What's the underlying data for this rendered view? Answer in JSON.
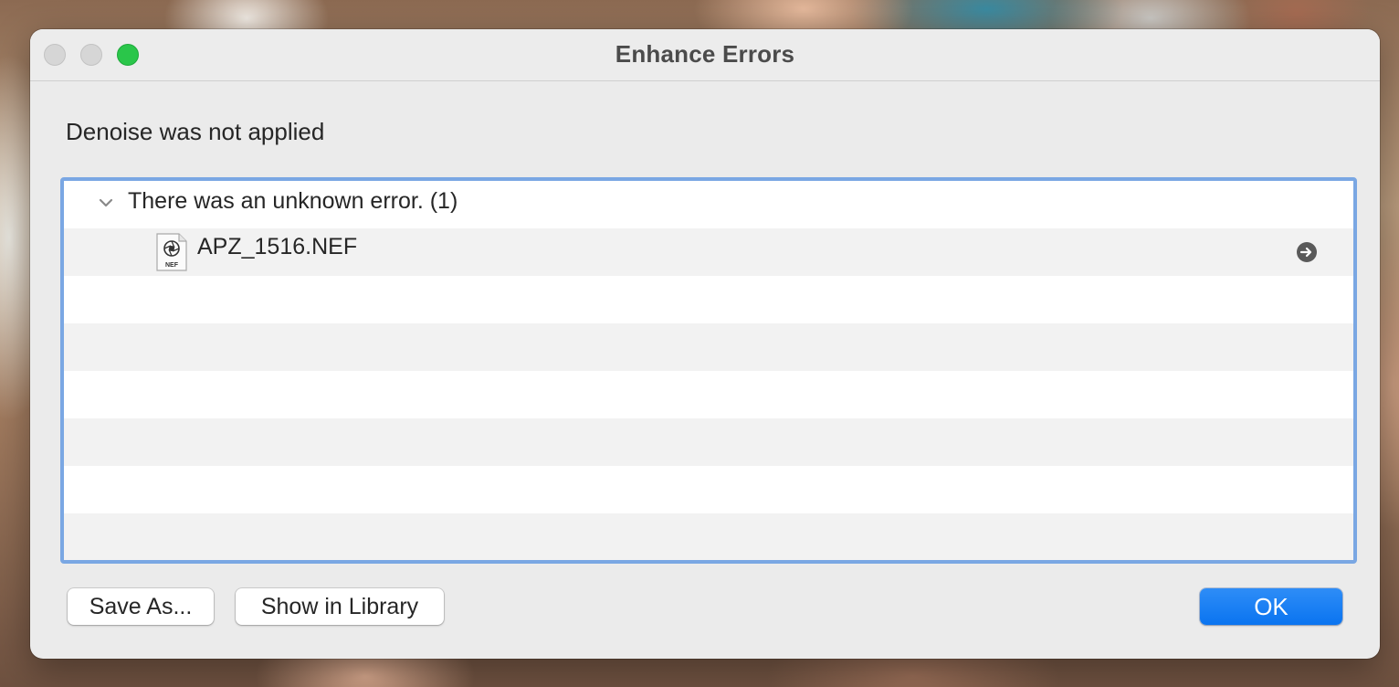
{
  "window": {
    "title": "Enhance Errors"
  },
  "dialog": {
    "message": "Denoise was not applied",
    "errors": [
      {
        "label": "There was an unknown error. (1)",
        "expanded": true,
        "files": [
          {
            "name": "APZ_1516.NEF",
            "file_type_badge": "NEF"
          }
        ]
      }
    ]
  },
  "buttons": {
    "save_as": "Save As...",
    "show_in_library": "Show in Library",
    "ok": "OK"
  },
  "colors": {
    "accent": "#0a74f0",
    "list_focus_ring": "#7aa7e3",
    "zoom_button": "#2ac64a"
  },
  "icons": {
    "group_toggle": "chevron-down-icon",
    "file": "nef-file-icon",
    "row_action": "arrow-right-circle-icon"
  }
}
